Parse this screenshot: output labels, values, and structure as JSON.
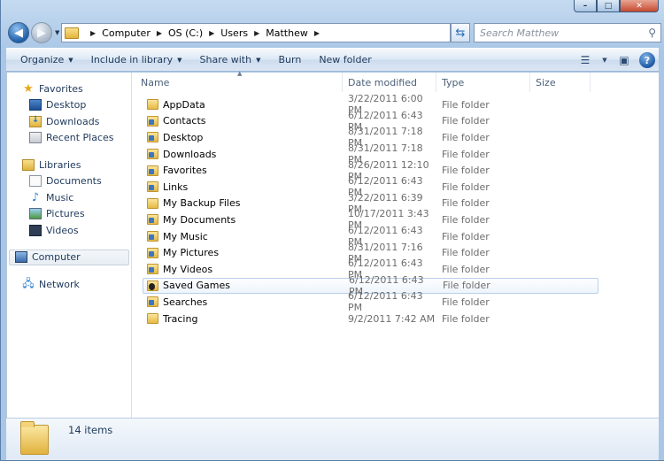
{
  "window": {
    "caption_buttons": [
      "–",
      "□",
      "✕"
    ]
  },
  "address": {
    "crumbs": [
      "Computer",
      "OS (C:)",
      "Users",
      "Matthew"
    ],
    "search_placeholder": "Search Matthew"
  },
  "toolbar": {
    "commands": [
      {
        "label": "Organize",
        "dropdown": true
      },
      {
        "label": "Include in library",
        "dropdown": true
      },
      {
        "label": "Share with",
        "dropdown": true
      },
      {
        "label": "Burn",
        "dropdown": false
      },
      {
        "label": "New folder",
        "dropdown": false
      }
    ],
    "help_label": "?"
  },
  "nav": {
    "favorites": {
      "label": "Favorites",
      "items": [
        "Desktop",
        "Downloads",
        "Recent Places"
      ]
    },
    "libraries": {
      "label": "Libraries",
      "items": [
        "Documents",
        "Music",
        "Pictures",
        "Videos"
      ]
    },
    "computer": "Computer",
    "network": "Network"
  },
  "columns": {
    "name": "Name",
    "date": "Date modified",
    "type": "Type",
    "size": "Size"
  },
  "files": [
    {
      "name": "AppData",
      "date": "3/22/2011 6:00 PM",
      "type": "File folder",
      "icon": "folder"
    },
    {
      "name": "Contacts",
      "date": "6/12/2011 6:43 PM",
      "type": "File folder",
      "icon": "special"
    },
    {
      "name": "Desktop",
      "date": "8/31/2011 7:18 PM",
      "type": "File folder",
      "icon": "special"
    },
    {
      "name": "Downloads",
      "date": "8/31/2011 7:18 PM",
      "type": "File folder",
      "icon": "special"
    },
    {
      "name": "Favorites",
      "date": "8/26/2011 12:10 PM",
      "type": "File folder",
      "icon": "special"
    },
    {
      "name": "Links",
      "date": "6/12/2011 6:43 PM",
      "type": "File folder",
      "icon": "special"
    },
    {
      "name": "My Backup Files",
      "date": "3/22/2011 6:39 PM",
      "type": "File folder",
      "icon": "folder"
    },
    {
      "name": "My Documents",
      "date": "10/17/2011 3:43 PM",
      "type": "File folder",
      "icon": "special"
    },
    {
      "name": "My Music",
      "date": "6/12/2011 6:43 PM",
      "type": "File folder",
      "icon": "special"
    },
    {
      "name": "My Pictures",
      "date": "8/31/2011 7:16 PM",
      "type": "File folder",
      "icon": "special"
    },
    {
      "name": "My Videos",
      "date": "6/12/2011 6:43 PM",
      "type": "File folder",
      "icon": "special"
    },
    {
      "name": "Saved Games",
      "date": "6/12/2011 6:43 PM",
      "type": "File folder",
      "icon": "games"
    },
    {
      "name": "Searches",
      "date": "6/12/2011 6:43 PM",
      "type": "File folder",
      "icon": "special"
    },
    {
      "name": "Tracing",
      "date": "9/2/2011 7:42 AM",
      "type": "File folder",
      "icon": "folder"
    }
  ],
  "details": {
    "count": "14 items"
  }
}
